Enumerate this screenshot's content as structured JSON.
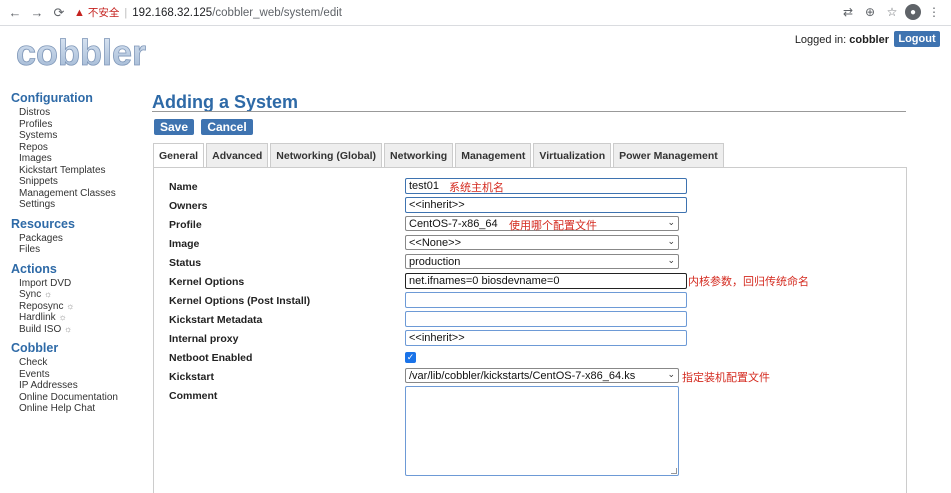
{
  "browser": {
    "back_icon": "←",
    "forward_icon": "→",
    "reload_icon": "⟳",
    "warning_icon": "▲",
    "insecure_label": "不安全",
    "url_host": "192.168.32.125",
    "url_path": "/cobbler_web/system/edit",
    "translate_icon": "⇄",
    "zoom_icon": "⊕",
    "star_icon": "☆",
    "profile_icon": "●",
    "menu_icon": "⋮"
  },
  "header": {
    "logo_text": "cobbler",
    "logged_in_label": "Logged in:",
    "username": "cobbler",
    "logout_label": "Logout"
  },
  "sidebar": {
    "configuration": {
      "title": "Configuration",
      "items": [
        "Distros",
        "Profiles",
        "Systems",
        "Repos",
        "Images",
        "Kickstart Templates",
        "Snippets",
        "Management Classes",
        "Settings"
      ]
    },
    "resources": {
      "title": "Resources",
      "items": [
        "Packages",
        "Files"
      ]
    },
    "actions": {
      "title": "Actions",
      "items": [
        {
          "label": "Import DVD",
          "gear": ""
        },
        {
          "label": "Sync",
          "gear": "☼"
        },
        {
          "label": "Reposync",
          "gear": "☼"
        },
        {
          "label": "Hardlink",
          "gear": "☼"
        },
        {
          "label": "Build ISO",
          "gear": "☼"
        }
      ]
    },
    "cobbler": {
      "title": "Cobbler",
      "items": [
        "Check",
        "Events",
        "IP Addresses",
        "Online Documentation",
        "Online Help Chat"
      ]
    }
  },
  "main": {
    "title": "Adding a System",
    "save_label": "Save",
    "cancel_label": "Cancel",
    "tabs": [
      "General",
      "Advanced",
      "Networking (Global)",
      "Networking",
      "Management",
      "Virtualization",
      "Power Management"
    ],
    "active_tab": "General"
  },
  "form": {
    "name": {
      "label": "Name",
      "value": "test01",
      "annotation": "系统主机名"
    },
    "owners": {
      "label": "Owners",
      "value": "<<inherit>>"
    },
    "profile": {
      "label": "Profile",
      "value": "CentOS-7-x86_64",
      "annotation": "使用哪个配置文件"
    },
    "image": {
      "label": "Image",
      "value": "<<None>>"
    },
    "status": {
      "label": "Status",
      "value": "production"
    },
    "kernel_options": {
      "label": "Kernel Options",
      "value": "net.ifnames=0 biosdevname=0",
      "annotation": "内核参数，回归传统命名"
    },
    "kernel_options_post": {
      "label": "Kernel Options (Post Install)",
      "value": ""
    },
    "kickstart_metadata": {
      "label": "Kickstart Metadata",
      "value": ""
    },
    "internal_proxy": {
      "label": "Internal proxy",
      "value": "<<inherit>>"
    },
    "netboot_enabled": {
      "label": "Netboot Enabled",
      "checked": true
    },
    "kickstart": {
      "label": "Kickstart",
      "value": "/var/lib/cobbler/kickstarts/CentOS-7-x86_64.ks",
      "annotation": "指定装机配置文件"
    },
    "comment": {
      "label": "Comment",
      "value": ""
    }
  }
}
